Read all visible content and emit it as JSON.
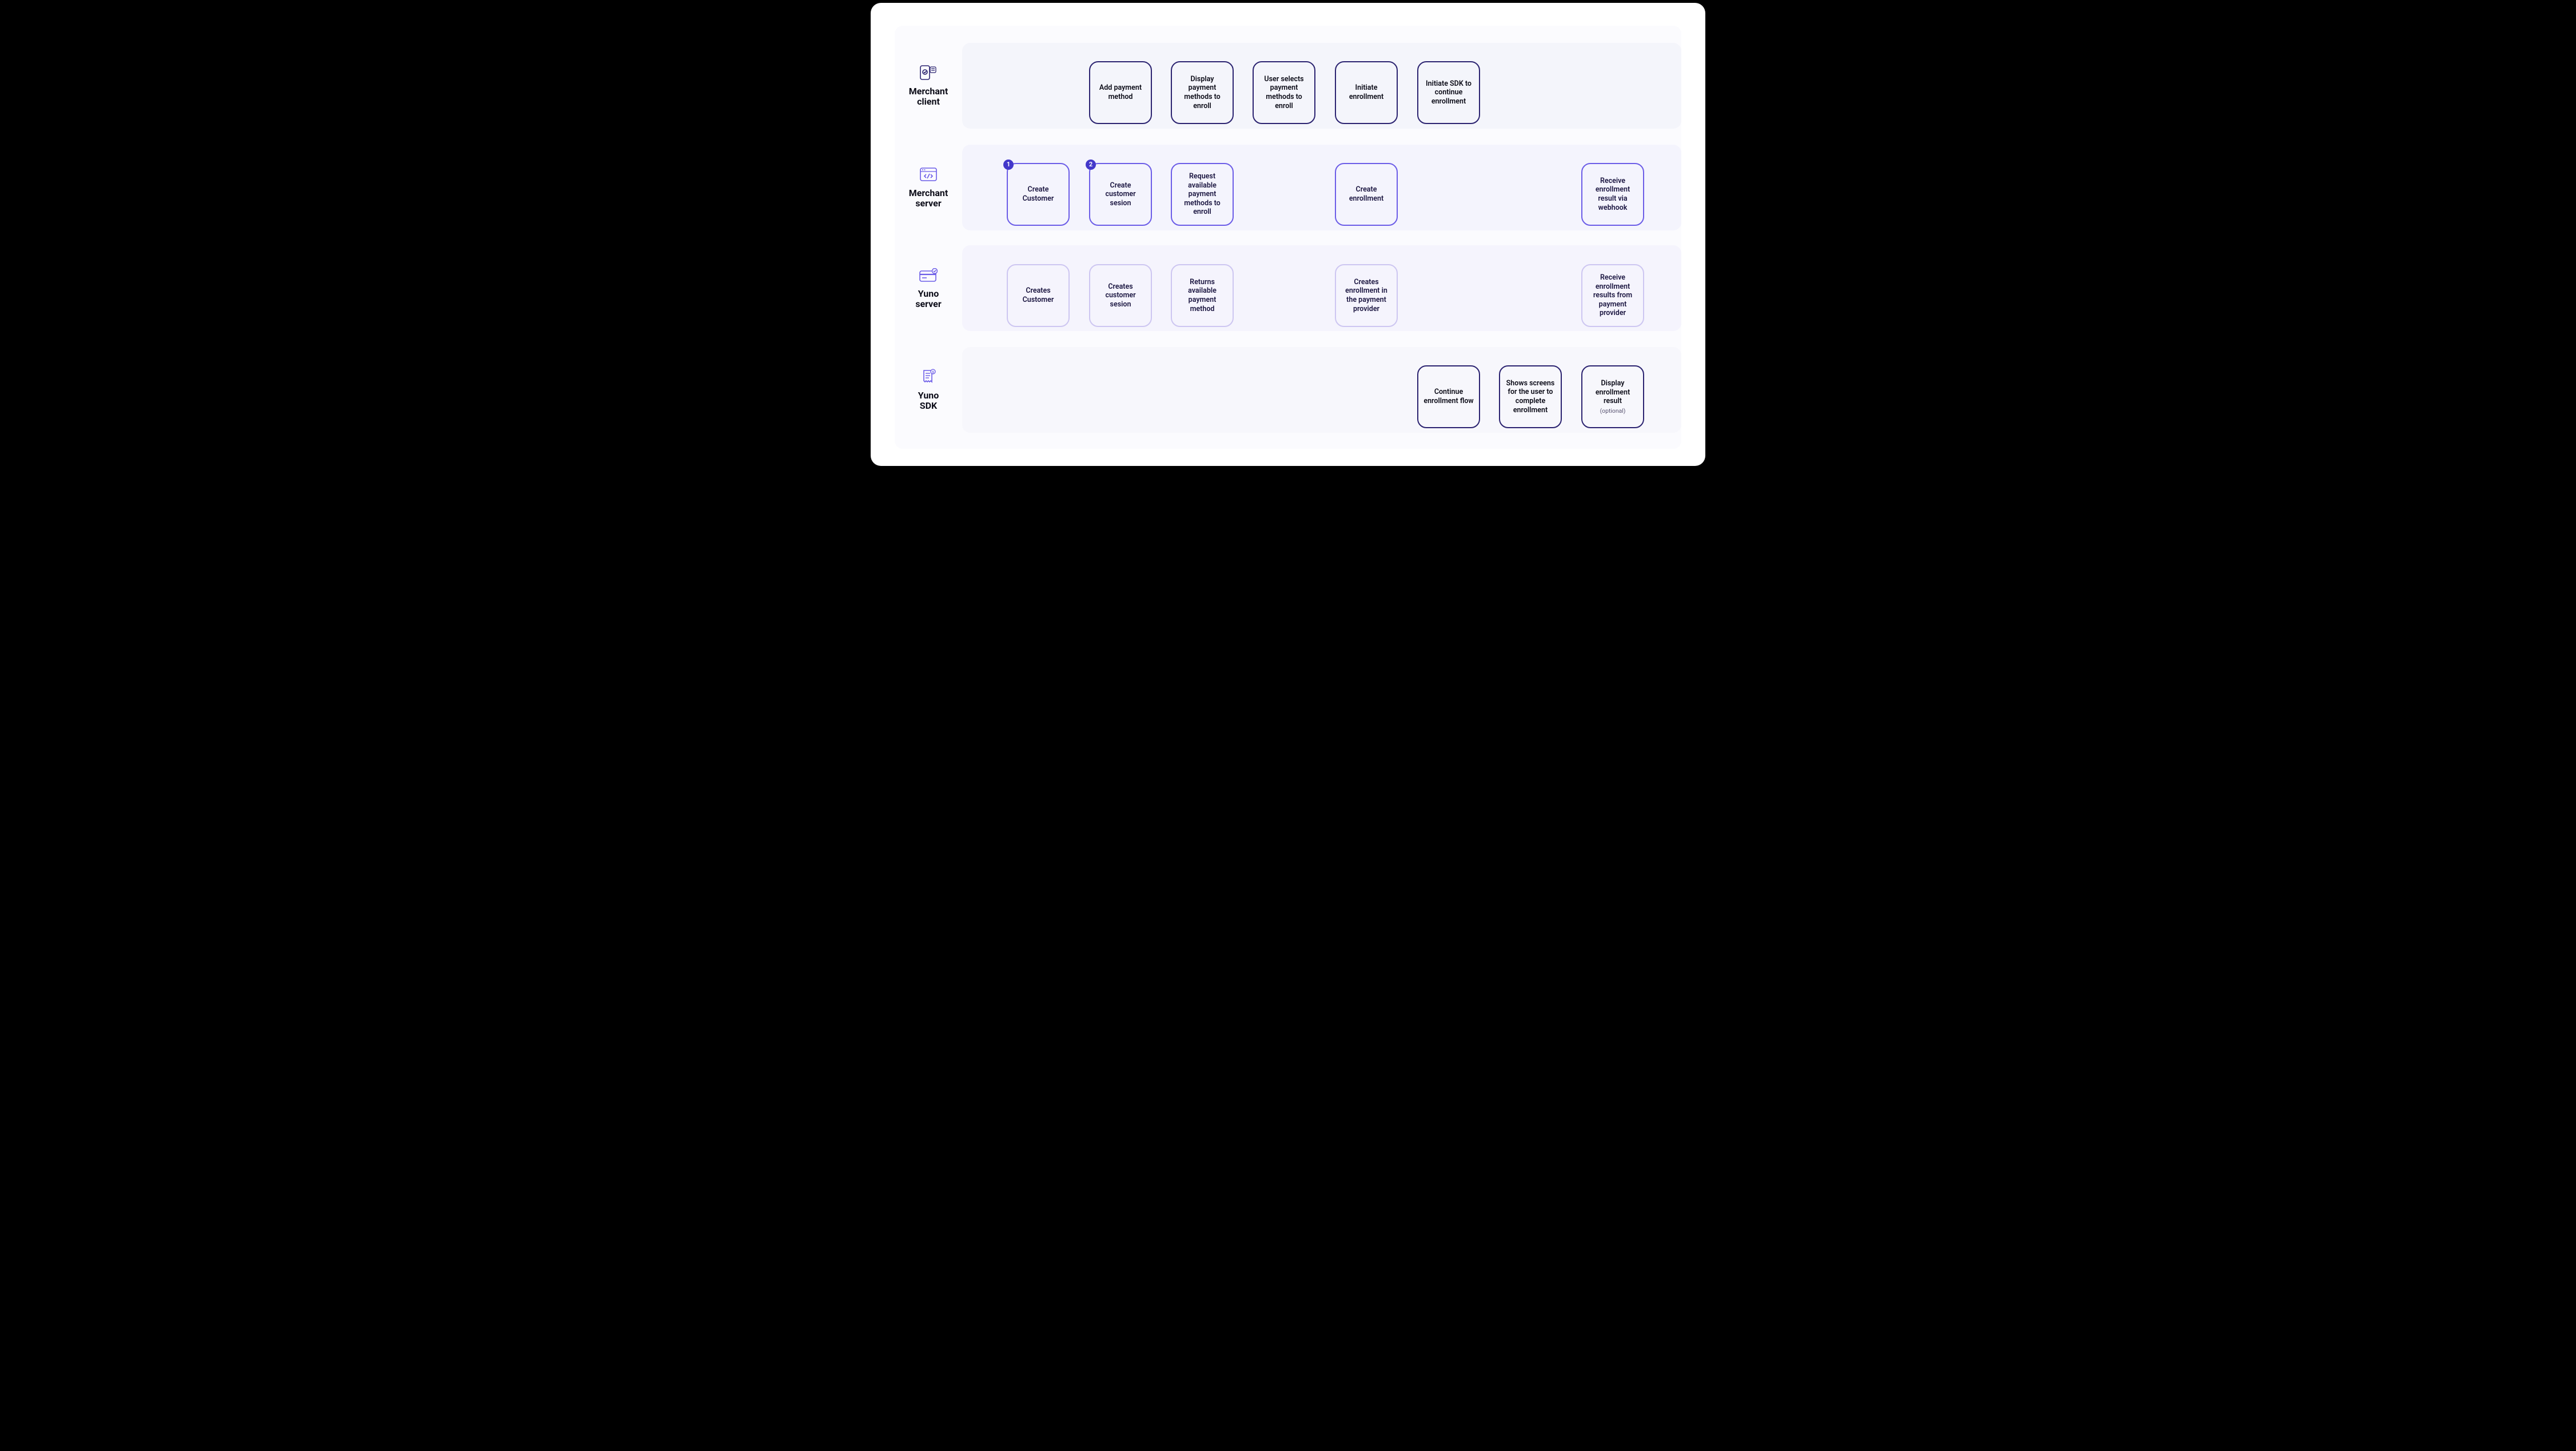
{
  "lanes": {
    "client": {
      "label_line1": "Merchant",
      "label_line2": "client"
    },
    "merchant": {
      "label_line1": "Merchant",
      "label_line2": "server"
    },
    "yuno": {
      "label_line1": "Yuno",
      "label_line2": "server"
    },
    "sdk": {
      "label_line1": "Yuno",
      "label_line2": "SDK"
    }
  },
  "boxes": {
    "c1": "Add payment method",
    "c2": "Display payment methods to enroll",
    "c3": "User selects payment methods to enroll",
    "c4": "Initiate enrollment",
    "c5": "Initiate SDK to continue enrollment",
    "m0": "Create Customer",
    "m1": "Create customer sesion",
    "m2": "Request available payment methods to enroll",
    "m3": "Create enrollment",
    "m4": "Receive enrollment result via webhook",
    "y0": "Creates Customer",
    "y1": "Creates customer sesion",
    "y2": "Returns available payment method",
    "y3": "Creates enrollment in the payment provider",
    "y4": "Receive enrollment results from payment provider",
    "s1": "Continue enrollment flow",
    "s2": "Shows screens for the user to complete enrollment",
    "s3_main": "Display enrollment result",
    "s3_sub": "(optional)"
  },
  "badges": {
    "m0": "1",
    "m1": "2"
  }
}
